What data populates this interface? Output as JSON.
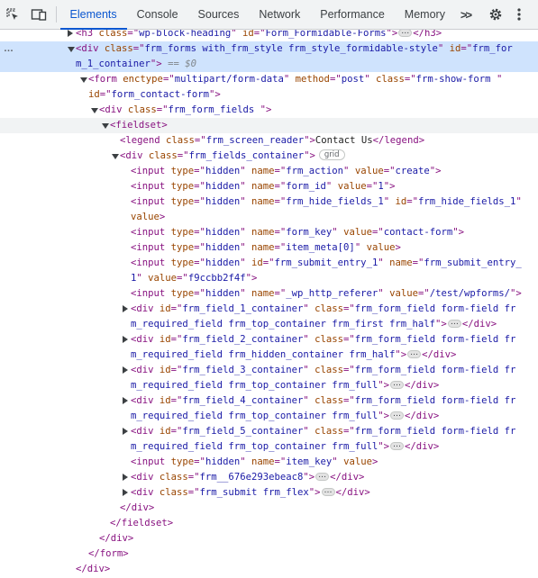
{
  "toolbar": {
    "tabs": [
      {
        "label": "Elements",
        "active": true
      },
      {
        "label": "Console"
      },
      {
        "label": "Sources"
      },
      {
        "label": "Network"
      },
      {
        "label": "Performance"
      },
      {
        "label": "Memory"
      }
    ],
    "more_tabs_label": ">>",
    "icons": [
      "inspect-element-icon",
      "device-toolbar-icon",
      "more-tabs-icon",
      "settings-gear-icon",
      "kebab-menu-icon"
    ],
    "accent_color": "#0b57d0"
  },
  "tree": {
    "lines": [
      {
        "indent": 84,
        "arrow": "right",
        "parts": [
          [
            "t",
            "<h3 "
          ],
          [
            "an",
            "class"
          ],
          [
            "t",
            "=\""
          ],
          [
            "av",
            "wp-block-heading"
          ],
          [
            "t",
            "\" "
          ],
          [
            "an",
            "id"
          ],
          [
            "t",
            "=\""
          ],
          [
            "av",
            "Form_Formidable-Forms"
          ],
          [
            "t",
            "\">"
          ],
          [
            "ell",
            "…"
          ],
          [
            "t",
            "</h3>"
          ]
        ]
      },
      {
        "indent": 84,
        "arrow": "down",
        "selected": true,
        "dots": "…",
        "parts": [
          [
            "t",
            "<div "
          ],
          [
            "an",
            "class"
          ],
          [
            "t",
            "=\""
          ],
          [
            "av",
            "frm_forms  with_frm_style frm_style_formidable-style"
          ],
          [
            "t",
            "\" "
          ],
          [
            "an",
            "id"
          ],
          [
            "t",
            "=\""
          ],
          [
            "av",
            "frm_for"
          ]
        ]
      },
      {
        "indent": 84,
        "selected": true,
        "parts": [
          [
            "av",
            "m_1_container"
          ],
          [
            "t",
            "\">"
          ],
          [
            "cm",
            " == $0"
          ]
        ]
      },
      {
        "indent": 98,
        "arrow": "down",
        "parts": [
          [
            "t",
            "<form "
          ],
          [
            "an",
            "enctype"
          ],
          [
            "t",
            "=\""
          ],
          [
            "av",
            "multipart/form-data"
          ],
          [
            "t",
            "\" "
          ],
          [
            "an",
            "method"
          ],
          [
            "t",
            "=\""
          ],
          [
            "av",
            "post"
          ],
          [
            "t",
            "\" "
          ],
          [
            "an",
            "class"
          ],
          [
            "t",
            "=\""
          ],
          [
            "av",
            "frm-show-form "
          ],
          [
            "t",
            "\""
          ]
        ]
      },
      {
        "indent": 98,
        "parts": [
          [
            "an",
            "id"
          ],
          [
            "t",
            "=\""
          ],
          [
            "av",
            "form_contact-form"
          ],
          [
            "t",
            "\">"
          ]
        ]
      },
      {
        "indent": 110,
        "arrow": "down",
        "parts": [
          [
            "t",
            "<div "
          ],
          [
            "an",
            "class"
          ],
          [
            "t",
            "=\""
          ],
          [
            "av",
            "frm_form_fields "
          ],
          [
            "t",
            "\">"
          ]
        ]
      },
      {
        "indent": 122,
        "arrow": "down",
        "hover": true,
        "parts": [
          [
            "t",
            "<fieldset>"
          ]
        ]
      },
      {
        "indent": 133,
        "parts": [
          [
            "t",
            "<legend "
          ],
          [
            "an",
            "class"
          ],
          [
            "t",
            "=\""
          ],
          [
            "av",
            "frm_screen_reader"
          ],
          [
            "t",
            "\">"
          ],
          [
            "tx",
            "Contact Us"
          ],
          [
            "t",
            "</legend>"
          ]
        ]
      },
      {
        "indent": 133,
        "arrow": "down",
        "parts": [
          [
            "t",
            "<div "
          ],
          [
            "an",
            "class"
          ],
          [
            "t",
            "=\""
          ],
          [
            "av",
            "frm_fields_container"
          ],
          [
            "t",
            "\">"
          ],
          [
            "badge",
            "grid"
          ]
        ]
      },
      {
        "indent": 145,
        "parts": [
          [
            "t",
            "<input "
          ],
          [
            "an",
            "type"
          ],
          [
            "t",
            "=\""
          ],
          [
            "av",
            "hidden"
          ],
          [
            "t",
            "\" "
          ],
          [
            "an",
            "name"
          ],
          [
            "t",
            "=\""
          ],
          [
            "av",
            "frm_action"
          ],
          [
            "t",
            "\" "
          ],
          [
            "an",
            "value"
          ],
          [
            "t",
            "=\""
          ],
          [
            "av",
            "create"
          ],
          [
            "t",
            "\">"
          ]
        ]
      },
      {
        "indent": 145,
        "parts": [
          [
            "t",
            "<input "
          ],
          [
            "an",
            "type"
          ],
          [
            "t",
            "=\""
          ],
          [
            "av",
            "hidden"
          ],
          [
            "t",
            "\" "
          ],
          [
            "an",
            "name"
          ],
          [
            "t",
            "=\""
          ],
          [
            "av",
            "form_id"
          ],
          [
            "t",
            "\" "
          ],
          [
            "an",
            "value"
          ],
          [
            "t",
            "=\""
          ],
          [
            "av",
            "1"
          ],
          [
            "t",
            "\">"
          ]
        ]
      },
      {
        "indent": 145,
        "parts": [
          [
            "t",
            "<input "
          ],
          [
            "an",
            "type"
          ],
          [
            "t",
            "=\""
          ],
          [
            "av",
            "hidden"
          ],
          [
            "t",
            "\" "
          ],
          [
            "an",
            "name"
          ],
          [
            "t",
            "=\""
          ],
          [
            "av",
            "frm_hide_fields_1"
          ],
          [
            "t",
            "\" "
          ],
          [
            "an",
            "id"
          ],
          [
            "t",
            "=\""
          ],
          [
            "av",
            "frm_hide_fields_1"
          ],
          [
            "t",
            "\""
          ]
        ]
      },
      {
        "indent": 145,
        "parts": [
          [
            "an",
            "value"
          ],
          [
            "t",
            ">"
          ]
        ]
      },
      {
        "indent": 145,
        "parts": [
          [
            "t",
            "<input "
          ],
          [
            "an",
            "type"
          ],
          [
            "t",
            "=\""
          ],
          [
            "av",
            "hidden"
          ],
          [
            "t",
            "\" "
          ],
          [
            "an",
            "name"
          ],
          [
            "t",
            "=\""
          ],
          [
            "av",
            "form_key"
          ],
          [
            "t",
            "\" "
          ],
          [
            "an",
            "value"
          ],
          [
            "t",
            "=\""
          ],
          [
            "av",
            "contact-form"
          ],
          [
            "t",
            "\">"
          ]
        ]
      },
      {
        "indent": 145,
        "parts": [
          [
            "t",
            "<input "
          ],
          [
            "an",
            "type"
          ],
          [
            "t",
            "=\""
          ],
          [
            "av",
            "hidden"
          ],
          [
            "t",
            "\" "
          ],
          [
            "an",
            "name"
          ],
          [
            "t",
            "=\""
          ],
          [
            "av",
            "item_meta[0]"
          ],
          [
            "t",
            "\" "
          ],
          [
            "an",
            "value"
          ],
          [
            "t",
            ">"
          ]
        ]
      },
      {
        "indent": 145,
        "parts": [
          [
            "t",
            "<input "
          ],
          [
            "an",
            "type"
          ],
          [
            "t",
            "=\""
          ],
          [
            "av",
            "hidden"
          ],
          [
            "t",
            "\" "
          ],
          [
            "an",
            "id"
          ],
          [
            "t",
            "=\""
          ],
          [
            "av",
            "frm_submit_entry_1"
          ],
          [
            "t",
            "\" "
          ],
          [
            "an",
            "name"
          ],
          [
            "t",
            "=\""
          ],
          [
            "av",
            "frm_submit_entry_"
          ]
        ]
      },
      {
        "indent": 145,
        "parts": [
          [
            "av",
            "1"
          ],
          [
            "t",
            "\" "
          ],
          [
            "an",
            "value"
          ],
          [
            "t",
            "=\""
          ],
          [
            "av",
            "f9ccbb2f4f"
          ],
          [
            "t",
            "\">"
          ]
        ]
      },
      {
        "indent": 145,
        "parts": [
          [
            "t",
            "<input "
          ],
          [
            "an",
            "type"
          ],
          [
            "t",
            "=\""
          ],
          [
            "av",
            "hidden"
          ],
          [
            "t",
            "\" "
          ],
          [
            "an",
            "name"
          ],
          [
            "t",
            "=\""
          ],
          [
            "av",
            "_wp_http_referer"
          ],
          [
            "t",
            "\" "
          ],
          [
            "an",
            "value"
          ],
          [
            "t",
            "=\""
          ],
          [
            "av",
            "/test/wpforms/"
          ],
          [
            "t",
            "\">"
          ]
        ]
      },
      {
        "indent": 145,
        "arrow": "right",
        "parts": [
          [
            "t",
            "<div "
          ],
          [
            "an",
            "id"
          ],
          [
            "t",
            "=\""
          ],
          [
            "av",
            "frm_field_1_container"
          ],
          [
            "t",
            "\" "
          ],
          [
            "an",
            "class"
          ],
          [
            "t",
            "=\""
          ],
          [
            "av",
            "frm_form_field form-field  fr"
          ]
        ]
      },
      {
        "indent": 145,
        "parts": [
          [
            "av",
            "m_required_field frm_top_container frm_first frm_half"
          ],
          [
            "t",
            "\">"
          ],
          [
            "ell",
            "…"
          ],
          [
            "t",
            "</div>"
          ]
        ]
      },
      {
        "indent": 145,
        "arrow": "right",
        "parts": [
          [
            "t",
            "<div "
          ],
          [
            "an",
            "id"
          ],
          [
            "t",
            "=\""
          ],
          [
            "av",
            "frm_field_2_container"
          ],
          [
            "t",
            "\" "
          ],
          [
            "an",
            "class"
          ],
          [
            "t",
            "=\""
          ],
          [
            "av",
            "frm_form_field form-field  fr"
          ]
        ]
      },
      {
        "indent": 145,
        "parts": [
          [
            "av",
            "m_required_field frm_hidden_container frm_half"
          ],
          [
            "t",
            "\">"
          ],
          [
            "ell",
            "…"
          ],
          [
            "t",
            "</div>"
          ]
        ]
      },
      {
        "indent": 145,
        "arrow": "right",
        "parts": [
          [
            "t",
            "<div "
          ],
          [
            "an",
            "id"
          ],
          [
            "t",
            "=\""
          ],
          [
            "av",
            "frm_field_3_container"
          ],
          [
            "t",
            "\" "
          ],
          [
            "an",
            "class"
          ],
          [
            "t",
            "=\""
          ],
          [
            "av",
            "frm_form_field form-field  fr"
          ]
        ]
      },
      {
        "indent": 145,
        "parts": [
          [
            "av",
            "m_required_field frm_top_container frm_full"
          ],
          [
            "t",
            "\">"
          ],
          [
            "ell",
            "…"
          ],
          [
            "t",
            "</div>"
          ]
        ]
      },
      {
        "indent": 145,
        "arrow": "right",
        "parts": [
          [
            "t",
            "<div "
          ],
          [
            "an",
            "id"
          ],
          [
            "t",
            "=\""
          ],
          [
            "av",
            "frm_field_4_container"
          ],
          [
            "t",
            "\" "
          ],
          [
            "an",
            "class"
          ],
          [
            "t",
            "=\""
          ],
          [
            "av",
            "frm_form_field form-field  fr"
          ]
        ]
      },
      {
        "indent": 145,
        "parts": [
          [
            "av",
            "m_required_field frm_top_container frm_full"
          ],
          [
            "t",
            "\">"
          ],
          [
            "ell",
            "…"
          ],
          [
            "t",
            "</div>"
          ]
        ]
      },
      {
        "indent": 145,
        "arrow": "right",
        "parts": [
          [
            "t",
            "<div "
          ],
          [
            "an",
            "id"
          ],
          [
            "t",
            "=\""
          ],
          [
            "av",
            "frm_field_5_container"
          ],
          [
            "t",
            "\" "
          ],
          [
            "an",
            "class"
          ],
          [
            "t",
            "=\""
          ],
          [
            "av",
            "frm_form_field form-field  fr"
          ]
        ]
      },
      {
        "indent": 145,
        "parts": [
          [
            "av",
            "m_required_field frm_top_container frm_full"
          ],
          [
            "t",
            "\">"
          ],
          [
            "ell",
            "…"
          ],
          [
            "t",
            "</div>"
          ]
        ]
      },
      {
        "indent": 145,
        "parts": [
          [
            "t",
            "<input "
          ],
          [
            "an",
            "type"
          ],
          [
            "t",
            "=\""
          ],
          [
            "av",
            "hidden"
          ],
          [
            "t",
            "\" "
          ],
          [
            "an",
            "name"
          ],
          [
            "t",
            "=\""
          ],
          [
            "av",
            "item_key"
          ],
          [
            "t",
            "\" "
          ],
          [
            "an",
            "value"
          ],
          [
            "t",
            ">"
          ]
        ]
      },
      {
        "indent": 145,
        "arrow": "right",
        "parts": [
          [
            "t",
            "<div "
          ],
          [
            "an",
            "class"
          ],
          [
            "t",
            "=\""
          ],
          [
            "av",
            "frm__676e293ebeac8"
          ],
          [
            "t",
            "\">"
          ],
          [
            "ell",
            "…"
          ],
          [
            "t",
            "</div>"
          ]
        ]
      },
      {
        "indent": 145,
        "arrow": "right",
        "parts": [
          [
            "t",
            "<div "
          ],
          [
            "an",
            "class"
          ],
          [
            "t",
            "=\""
          ],
          [
            "av",
            "frm_submit frm_flex"
          ],
          [
            "t",
            "\">"
          ],
          [
            "ell",
            "…"
          ],
          [
            "t",
            "</div>"
          ]
        ]
      },
      {
        "indent": 133,
        "parts": [
          [
            "t",
            "</div>"
          ]
        ]
      },
      {
        "indent": 122,
        "parts": [
          [
            "t",
            "</fieldset>"
          ]
        ]
      },
      {
        "indent": 110,
        "parts": [
          [
            "t",
            "</div>"
          ]
        ]
      },
      {
        "indent": 98,
        "parts": [
          [
            "t",
            "</form>"
          ]
        ]
      },
      {
        "indent": 84,
        "parts": [
          [
            "t",
            "</div>"
          ]
        ]
      }
    ]
  }
}
